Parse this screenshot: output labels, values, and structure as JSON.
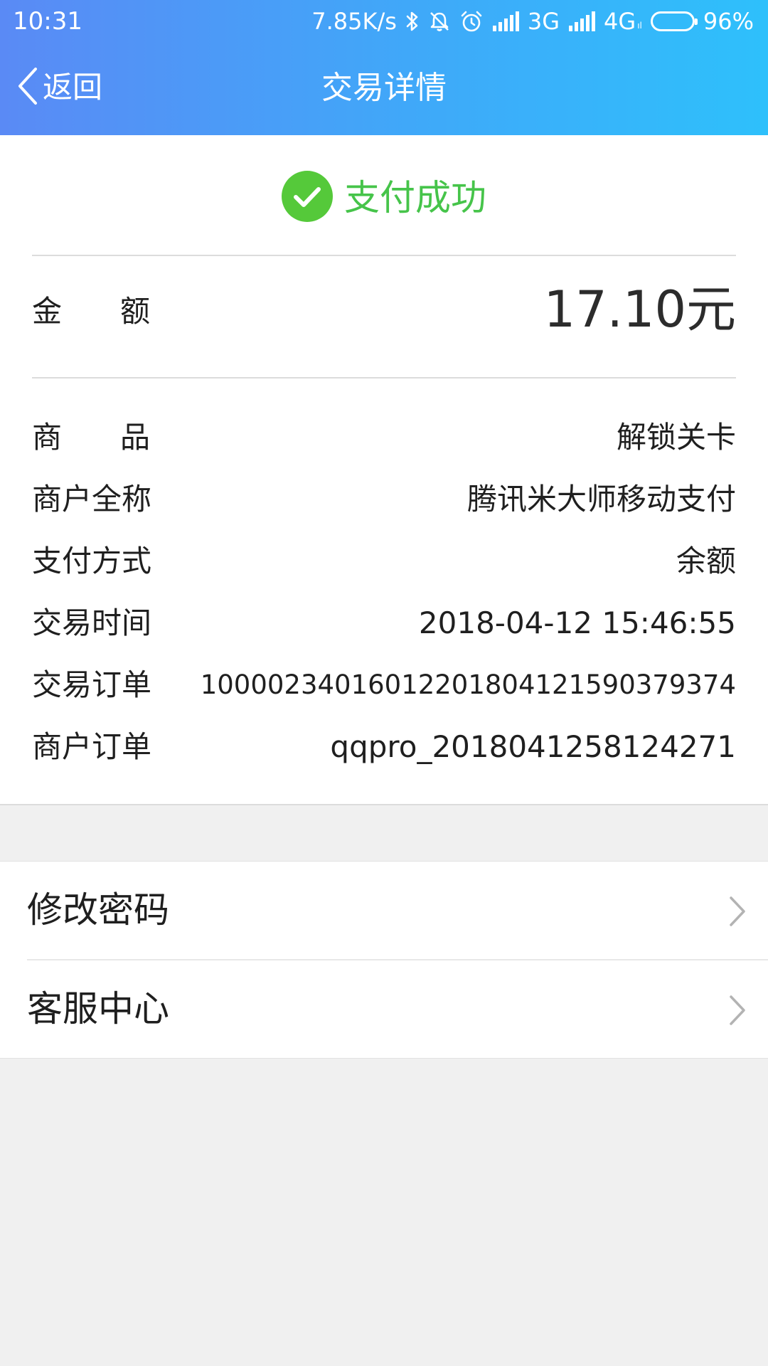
{
  "status_bar": {
    "time": "10:31",
    "net_speed": "7.85K/s",
    "network_1": "3G",
    "network_2": "4G",
    "network_2_sub": "ıl",
    "battery": "96%",
    "icons": [
      "bluetooth-icon",
      "mute-bell-icon",
      "alarm-icon",
      "signal-icon",
      "signal-icon",
      "battery-icon"
    ]
  },
  "nav": {
    "back_label": "返回",
    "title": "交易详情"
  },
  "result": {
    "status_text": "支付成功",
    "status_color": "#46c44a"
  },
  "amount": {
    "label": "金额",
    "value": "17.10元"
  },
  "details": [
    {
      "label": "商品",
      "value": "解锁关卡"
    },
    {
      "label": "商户全称",
      "value": "腾讯米大师移动支付"
    },
    {
      "label": "支付方式",
      "value": "余额"
    },
    {
      "label": "交易时间",
      "value": "2018-04-12 15:46:55"
    },
    {
      "label": "交易订单",
      "value": "10000234016012201804121590379374"
    },
    {
      "label": "商户订单",
      "value": "qqpro_2018041258124271"
    }
  ],
  "menu": [
    {
      "label": "修改密码",
      "icon": "chevron-right-icon"
    },
    {
      "label": "客服中心",
      "icon": "chevron-right-icon"
    }
  ],
  "colors": {
    "header_gradient_start": "#5a8af5",
    "header_gradient_end": "#2ec0fb",
    "success_green": "#46c44a",
    "page_background": "#f0f0f0"
  }
}
